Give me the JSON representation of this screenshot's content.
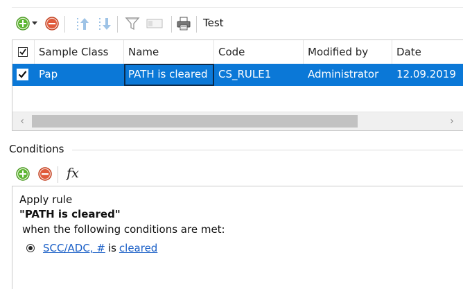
{
  "toolbar": {
    "test_label": "Test",
    "icons": [
      "add-icon",
      "dropdown-arrow-icon",
      "remove-icon",
      "move-up-icon",
      "move-down-icon",
      "filter-icon",
      "clear-filter-icon",
      "print-icon"
    ]
  },
  "grid": {
    "columns": [
      "Sample Class",
      "Name",
      "Code",
      "Modified by",
      "Date"
    ],
    "rows": [
      {
        "checked": true,
        "sample_class": "Pap",
        "name": "PATH is cleared",
        "code": "CS_RULE1",
        "modified_by": "Administrator",
        "date": "12.09.2019"
      }
    ]
  },
  "conditions": {
    "title": "Conditions",
    "apply": "Apply rule",
    "rule_name": "\"PATH is cleared\"",
    "when": "when the following conditions are met:",
    "items": [
      {
        "field": "SCC/ADC, #",
        "operator": "is",
        "value": "cleared"
      }
    ]
  },
  "colors": {
    "selection": "#0b78d7",
    "link": "#1a5fc7",
    "add_green": "#5cb531",
    "remove_red": "#e05a3a"
  }
}
